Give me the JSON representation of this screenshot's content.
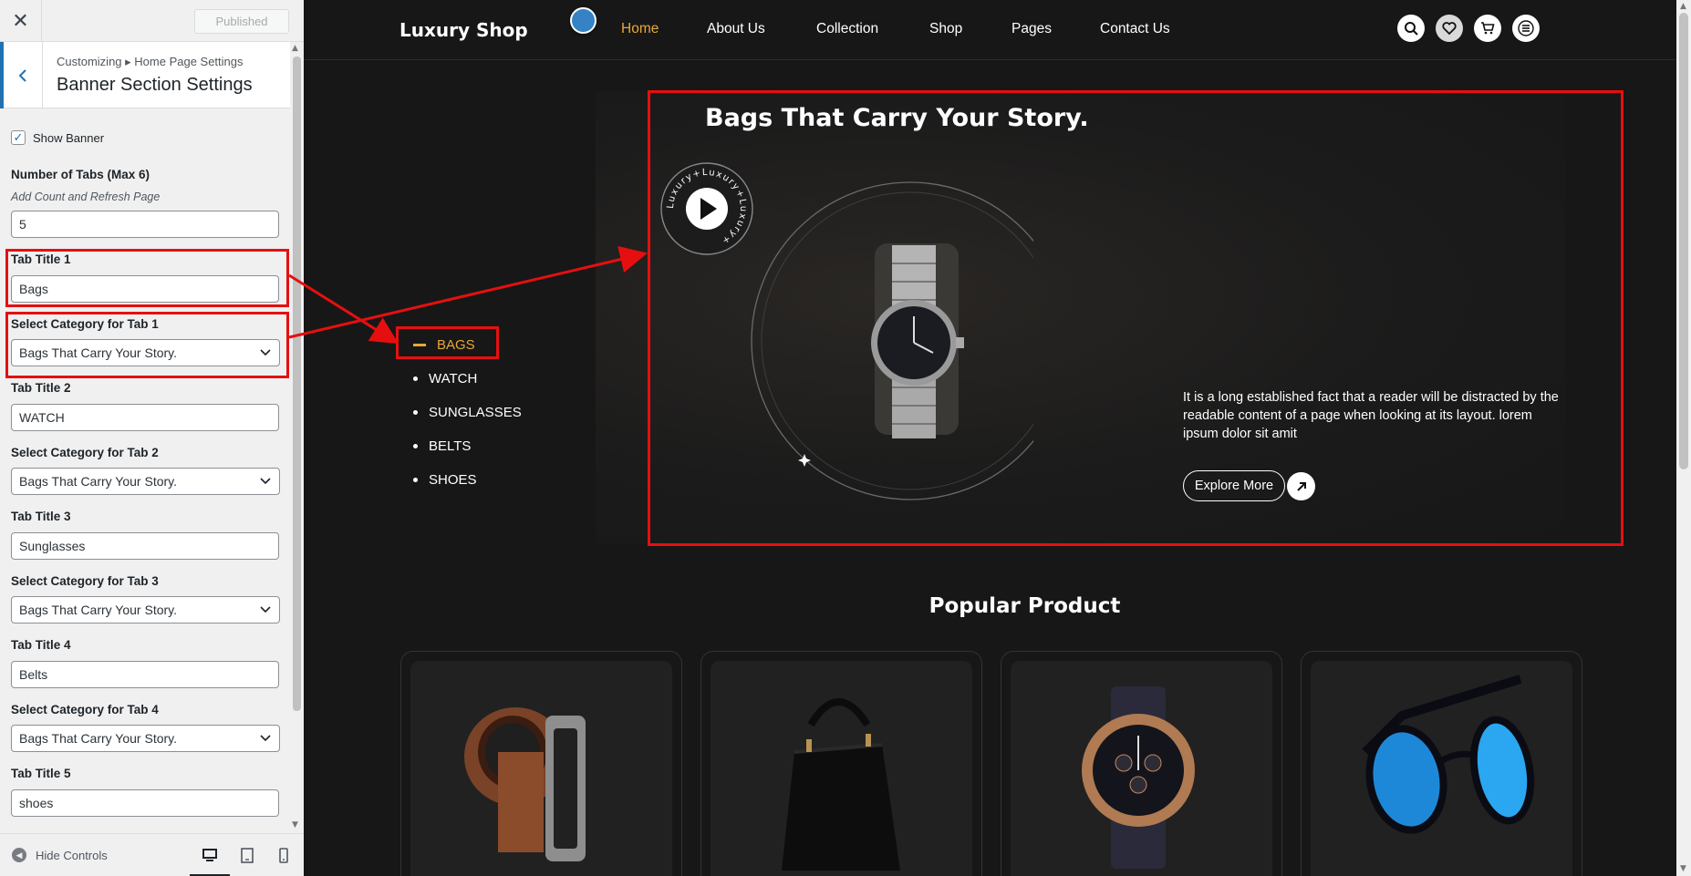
{
  "customizer": {
    "close_label": "✕",
    "publish_label": "Published",
    "breadcrumb": "Customizing ▸ Home Page Settings",
    "section_title": "Banner Section Settings",
    "show_banner_label": "Show Banner",
    "show_banner_checked": true,
    "num_tabs_label": "Number of Tabs (Max 6)",
    "num_tabs_desc": "Add Count and Refresh Page",
    "num_tabs_value": "5",
    "fields": [
      {
        "title_label": "Tab Title 1",
        "title_value": "Bags",
        "cat_label": "Select Category for Tab 1",
        "cat_value": "Bags That Carry Your Story."
      },
      {
        "title_label": "Tab Title 2",
        "title_value": "WATCH",
        "cat_label": "Select Category for Tab 2",
        "cat_value": "Bags That Carry Your Story."
      },
      {
        "title_label": "Tab Title 3",
        "title_value": "Sunglasses",
        "cat_label": "Select Category for Tab 3",
        "cat_value": "Bags That Carry Your Story."
      },
      {
        "title_label": "Tab Title 4",
        "title_value": "Belts",
        "cat_label": "Select Category for Tab 4",
        "cat_value": "Bags That Carry Your Story."
      },
      {
        "title_label": "Tab Title 5",
        "title_value": "shoes"
      }
    ],
    "hide_controls_label": "Hide Controls",
    "devices": [
      "desktop-icon",
      "tablet-icon",
      "mobile-icon"
    ]
  },
  "site": {
    "logo": "Luxury Shop",
    "nav": [
      "Home",
      "About Us",
      "Collection",
      "Shop",
      "Pages",
      "Contact Us"
    ],
    "nav_active": "Home",
    "nav_icons": [
      "search-icon",
      "heart-icon",
      "cart-icon",
      "menu-icon"
    ],
    "tabs": [
      "BAGS",
      "WATCH",
      "SUNGLASSES",
      "BELTS",
      "SHOES"
    ],
    "active_tab": "BAGS",
    "banner_title": "Bags That Carry Your Story.",
    "video_badge_text": "Luxury+Luxury+Luxury+",
    "banner_desc": "It is a long established fact that a reader will be distracted by the readable content of a page when looking at its layout. lorem ipsum dolor sit amit",
    "explore_label": "Explore More",
    "popular_title": "Popular Product",
    "products": [
      "belt",
      "handbag",
      "wristwatch",
      "sunglasses"
    ]
  },
  "colors": {
    "accent": "#e8a838",
    "annotation_red": "#e60f0f",
    "wp_blue": "#2271b1",
    "bg_dark": "#171717"
  }
}
